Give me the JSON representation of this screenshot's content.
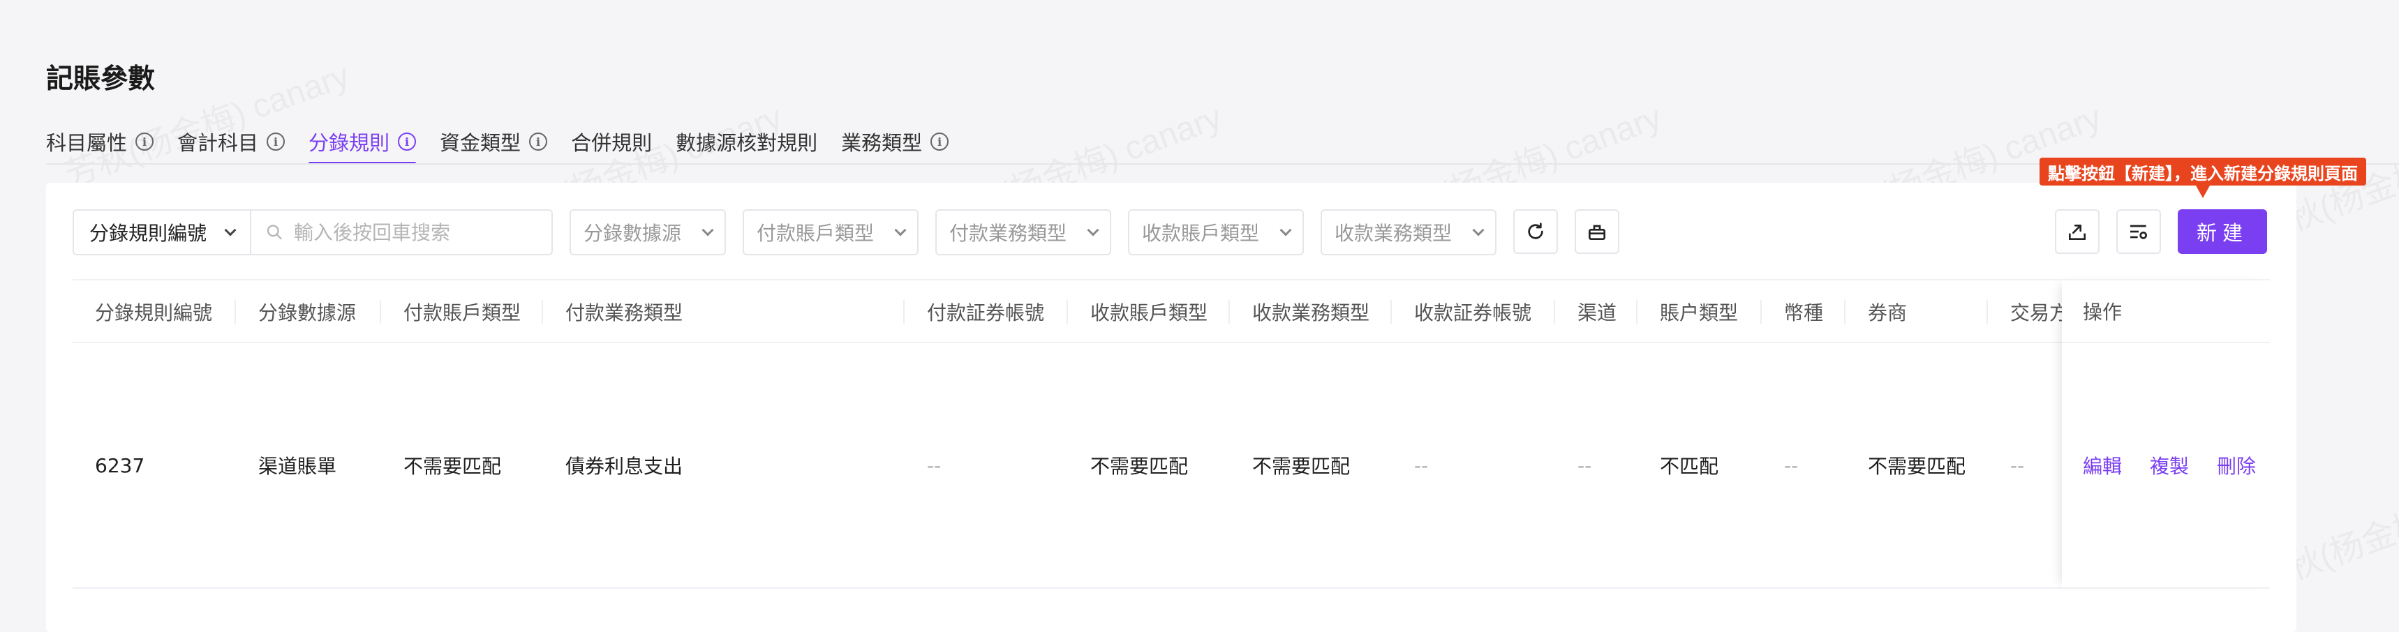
{
  "page": {
    "title": "記賬參數"
  },
  "tabs": [
    {
      "label": "科目屬性",
      "info": true,
      "active": false
    },
    {
      "label": "會計科目",
      "info": true,
      "active": false
    },
    {
      "label": "分錄規則",
      "info": true,
      "active": true
    },
    {
      "label": "資金類型",
      "info": true,
      "active": false
    },
    {
      "label": "合併規則",
      "info": false,
      "active": false
    },
    {
      "label": "數據源核對規則",
      "info": false,
      "active": false
    },
    {
      "label": "業務類型",
      "info": true,
      "active": false
    }
  ],
  "toolbar": {
    "search_field_select": "分錄規則編號",
    "search_placeholder": "輸入後按回車搜索",
    "filters": [
      "分錄數據源",
      "付款賬戶類型",
      "付款業務類型",
      "收款賬戶類型",
      "收款業務類型"
    ],
    "new_button": "新建",
    "tooltip": "點擊按鈕【新建】，進入新建分錄規則頁面"
  },
  "table": {
    "columns": [
      "分錄規則編號",
      "分錄數據源",
      "付款賬戶類型",
      "付款業務類型",
      "付款証券帳號",
      "收款賬戶類型",
      "收款業務類型",
      "收款証券帳號",
      "渠道",
      "賬户類型",
      "幣種",
      "券商",
      "交易方"
    ],
    "rows": [
      [
        "6237",
        "渠道賬單",
        "不需要匹配",
        "債券利息支出",
        "--",
        "不需要匹配",
        "不需要匹配",
        "--",
        "--",
        "不匹配",
        "--",
        "不需要匹配",
        "--"
      ]
    ],
    "actions_header": "操作",
    "actions": [
      "編輯",
      "複製",
      "刪除"
    ]
  },
  "watermark": "芳秋(杨金梅) canary",
  "colors": {
    "accent": "#7b3ff2",
    "tooltip": "#e8451e"
  }
}
